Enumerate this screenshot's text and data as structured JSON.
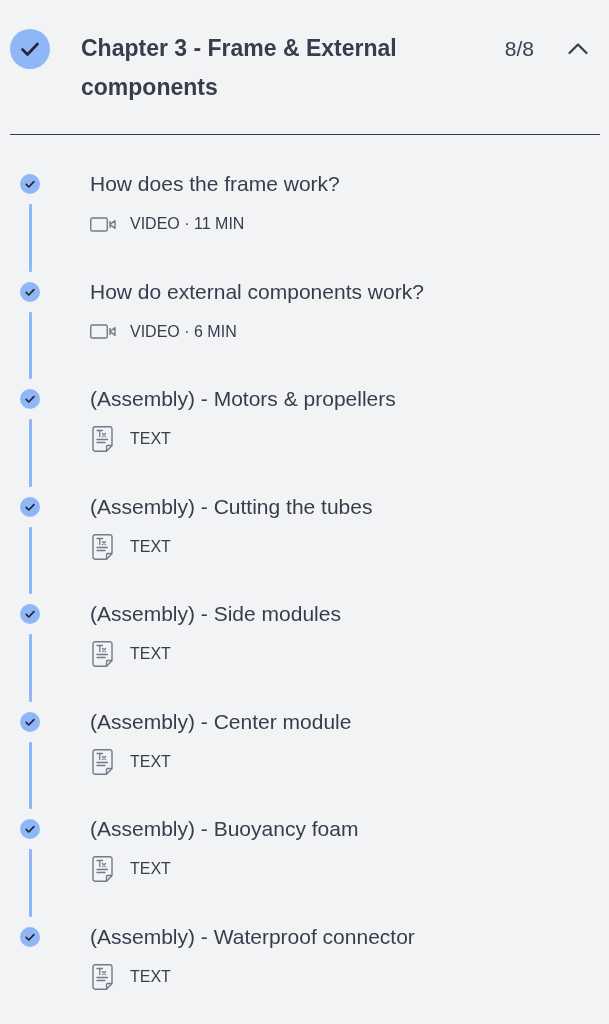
{
  "chapter": {
    "title": "Chapter 3 - Frame & External components",
    "completed": true,
    "lesson_count": "8/8",
    "expanded": true
  },
  "lessons": [
    {
      "title": "How does the frame work?",
      "completed": true,
      "kind": "video",
      "meta": "VIDEO · 11 MIN"
    },
    {
      "title": "How do external components work?",
      "completed": true,
      "kind": "video",
      "meta": "VIDEO · 6 MIN"
    },
    {
      "title": "(Assembly) - Motors & propellers",
      "completed": true,
      "kind": "text",
      "meta": "TEXT"
    },
    {
      "title": "(Assembly) - Cutting the tubes",
      "completed": true,
      "kind": "text",
      "meta": "TEXT"
    },
    {
      "title": "(Assembly) - Side modules",
      "completed": true,
      "kind": "text",
      "meta": "TEXT"
    },
    {
      "title": "(Assembly) - Center module",
      "completed": true,
      "kind": "text",
      "meta": "TEXT"
    },
    {
      "title": "(Assembly) - Buoyancy foam",
      "completed": true,
      "kind": "text",
      "meta": "TEXT"
    },
    {
      "title": "(Assembly) - Waterproof connector",
      "completed": true,
      "kind": "text",
      "meta": "TEXT"
    }
  ]
}
